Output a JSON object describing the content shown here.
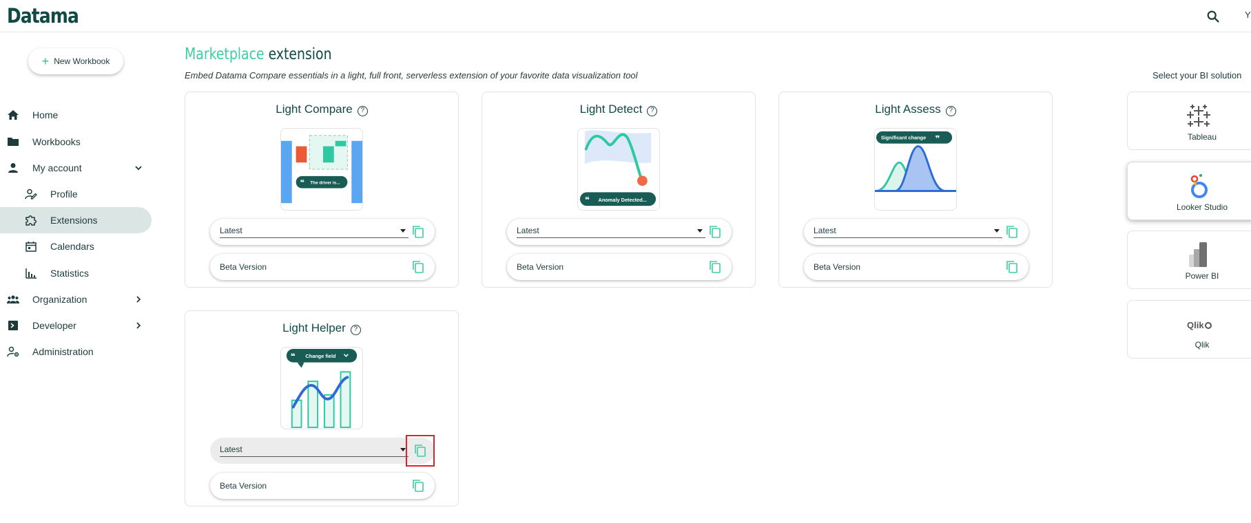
{
  "app": {
    "logo": "Datama",
    "user_initial": "Y"
  },
  "sidebar": {
    "new_workbook": "New Workbook",
    "items": [
      {
        "label": "Home",
        "icon": "home-icon"
      },
      {
        "label": "Workbooks",
        "icon": "folder-icon"
      },
      {
        "label": "My account",
        "icon": "person-icon"
      },
      {
        "label": "Profile",
        "icon": "profile-edit-icon"
      },
      {
        "label": "Extensions",
        "icon": "puzzle-icon"
      },
      {
        "label": "Calendars",
        "icon": "calendar-icon"
      },
      {
        "label": "Statistics",
        "icon": "bar-chart-icon"
      },
      {
        "label": "Organization",
        "icon": "group-icon"
      },
      {
        "label": "Developer",
        "icon": "terminal-icon"
      },
      {
        "label": "Administration",
        "icon": "admin-gear-icon"
      }
    ]
  },
  "main": {
    "title_accent": "Marketplace",
    "title_rest": "extension",
    "subtitle": "Embed Datama Compare essentials in a light, full front, serverless extension of your favorite data visualization tool",
    "cards": [
      {
        "title": "Light Compare",
        "select_value": "Latest",
        "beta_label": "Beta Version",
        "thumb_caption": "The driver is..."
      },
      {
        "title": "Light Detect",
        "select_value": "Latest",
        "beta_label": "Beta Version",
        "thumb_caption": "Anomaly Detected..."
      },
      {
        "title": "Light Assess",
        "select_value": "Latest",
        "beta_label": "Beta Version",
        "thumb_caption": "Significant change"
      },
      {
        "title": "Light Helper",
        "select_value": "Latest",
        "beta_label": "Beta Version",
        "thumb_caption": "Change field"
      }
    ]
  },
  "bi": {
    "label": "Select your BI solution",
    "options": [
      {
        "name": "Tableau",
        "icon": "tableau-icon"
      },
      {
        "name": "Looker Studio",
        "icon": "looker-studio-icon",
        "selected": true
      },
      {
        "name": "Power BI",
        "icon": "power-bi-icon"
      },
      {
        "name": "Qlik",
        "icon": "qlik-icon",
        "logo_text": "Qlik"
      }
    ]
  },
  "colors": {
    "accent": "#3ecda3",
    "brand": "#0f4a45",
    "highlight": "#d9242b"
  }
}
